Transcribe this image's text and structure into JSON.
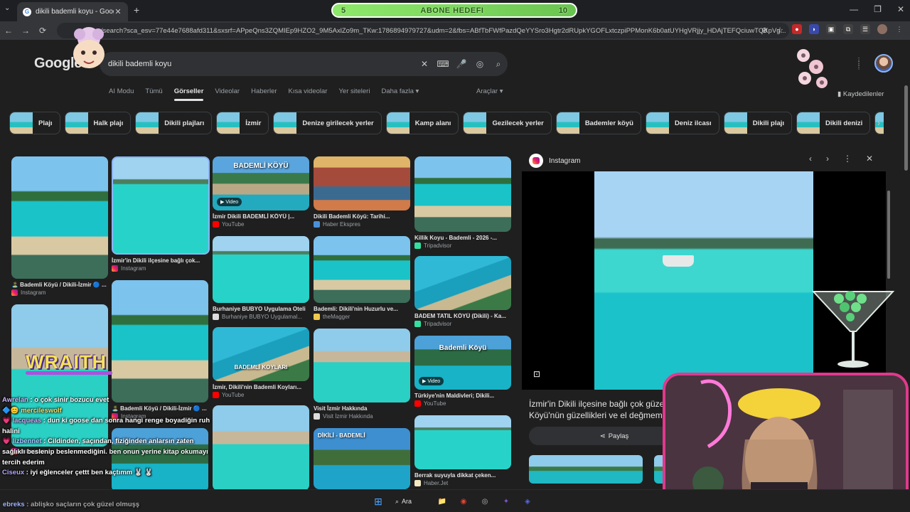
{
  "browser": {
    "tab_title": "dikili bademli koyu - Google'da",
    "tab_close": "✕",
    "new_tab": "+",
    "tab_dropdown": "⌄",
    "window_controls": [
      "—",
      "❐",
      "✕"
    ],
    "url": "/search?sca_esv=77e44e7688afd311&sxsrf=APpeQns3ZQMIEp9HZO2_9M5AxlZo9m_TKw:1786894979727&udm=2&fbs=ABfTbFWfPazdQeYYSro3Hgtr2dRUpkYGOFLxtczpiPPMonK6b0atUYHgVRjjy_HDAjTEFQciuwTQKpVg...",
    "nav": [
      "←",
      "→",
      "⟳"
    ],
    "omni_icons": [
      "⊘",
      "☆"
    ],
    "extensions": [
      "●",
      "◗",
      "▣",
      "⧉",
      "☰"
    ]
  },
  "overlay": {
    "goal_left": "5",
    "goal_label": "ABONE HEDEFI",
    "goal_right": "10",
    "goal_progress": 0.5,
    "wraith": "WRAITH"
  },
  "google": {
    "logo": "Google",
    "query": "dikili bademli koyu",
    "search_icons": [
      "✕",
      "⌨",
      "🎤",
      "◎",
      "⌕"
    ],
    "apps_icon": "⋮⋮⋮",
    "saved": "Kaydedilenler",
    "tabs": [
      "AI Modu",
      "Tümü",
      "Görseller",
      "Videolar",
      "Haberler",
      "Kısa videolar",
      "Yer siteleri",
      "Daha fazla ▾"
    ],
    "active_tab_index": 2,
    "tools": "Araçlar ▾",
    "chips": [
      "Plajı",
      "Halk plajı",
      "Dikili plajları",
      "İzmir",
      "Denize girilecek yerler",
      "Kamp alanı",
      "Gezilecek yerler",
      "Bademler köyü",
      "Deniz ilcası",
      "Dikili plajı",
      "Dikili denizi",
      "K"
    ],
    "chip_next": "›"
  },
  "results": [
    {
      "caption": "🏝️ Bademli Köyü / Dikili-İzmir 🔵 ...",
      "source": "Instagram"
    },
    {
      "caption": "İzmir'in Dikili ilçesine bağlı çok...",
      "source": "Instagram"
    },
    {
      "caption": "İzmir Dikili BADEMLİ KÖYÜ |...",
      "source": "YouTube",
      "badge": "▶ Video",
      "overlay": "BADEMLİ KÖYÜ"
    },
    {
      "caption": "Dikili Bademli Köyü: Tarihi...",
      "source": "Haber Ekspres"
    },
    {
      "caption": "Killik Koyu - Bademli - 2026 -...",
      "source": "Tripadvisor"
    },
    {
      "caption": "Burhaniye BUBYO Uygulama Oteli",
      "source": "Burhaniye BUBYO Uygulamal..."
    },
    {
      "caption": "Bademli: Dikili'nin Huzurlu ve...",
      "source": "theMagger"
    },
    {
      "caption": "BADEM TATIL KÖYÜ (Dikili) - Ka...",
      "source": "Tripadvisor"
    },
    {
      "caption": "İzmir, Dikili'nin Bademli Koyları...",
      "source": "YouTube",
      "overlay": "BADEMLİ KOYLARI"
    },
    {
      "caption": "Visit İzmir Hakkında",
      "source": "Visit İzmir Hakkında"
    },
    {
      "caption": "Türkiye'nin Maldivleri; Dikili...",
      "source": "YouTube",
      "badge": "▶ Video",
      "overlay": "Bademli Köyü"
    },
    {
      "caption": "🏝️ Bademli Köyü / Dikili-İzmir 🔵 ...",
      "source": "Instagram"
    },
    {
      "caption": "Berrak suyuyla dikkat çeken...",
      "source": "Haber.Jet"
    },
    {
      "caption": "",
      "source": "Instagram"
    },
    {
      "caption": "",
      "source": "",
      "overlay": "DİKİLİ - BADEMLİ"
    }
  ],
  "panel": {
    "source": "Instagram",
    "controls": [
      "‹",
      "›",
      "⋮",
      "✕"
    ],
    "title": "İzmir'in Dikili ilçesine bağlı çok güzel Köyü'nün güzellikleri ve el değmem",
    "share": "Paylaş",
    "lens_icon": "⊡"
  },
  "chat": [
    {
      "user": "Awrelan",
      "text": "o çok sinir bozucu evet"
    },
    {
      "user": "mercileswolf",
      "text": ""
    },
    {
      "user": "lacqueas",
      "text": "dun ki goose dan sonra hangi renge boyadiğin ruh halini"
    },
    {
      "user": "lizbennet",
      "text": "Cildinden, saçından, fiziğinden anlarsın zaten sağlıklı beslenip beslenmediğini. ben onun yerine kitap okumayı tercih ederim"
    },
    {
      "user": "Ciseux",
      "text": "iyi eğlenceler çettt ben kaçtımm 🐰 🐰"
    },
    {
      "user": "ebreks",
      "text": "ablişko saçların çok güzel olmuşş"
    }
  ],
  "taskbar": {
    "search": "Ara",
    "icons": [
      "⊞",
      "📁",
      "◉",
      "◎",
      "✦",
      "◈"
    ]
  }
}
